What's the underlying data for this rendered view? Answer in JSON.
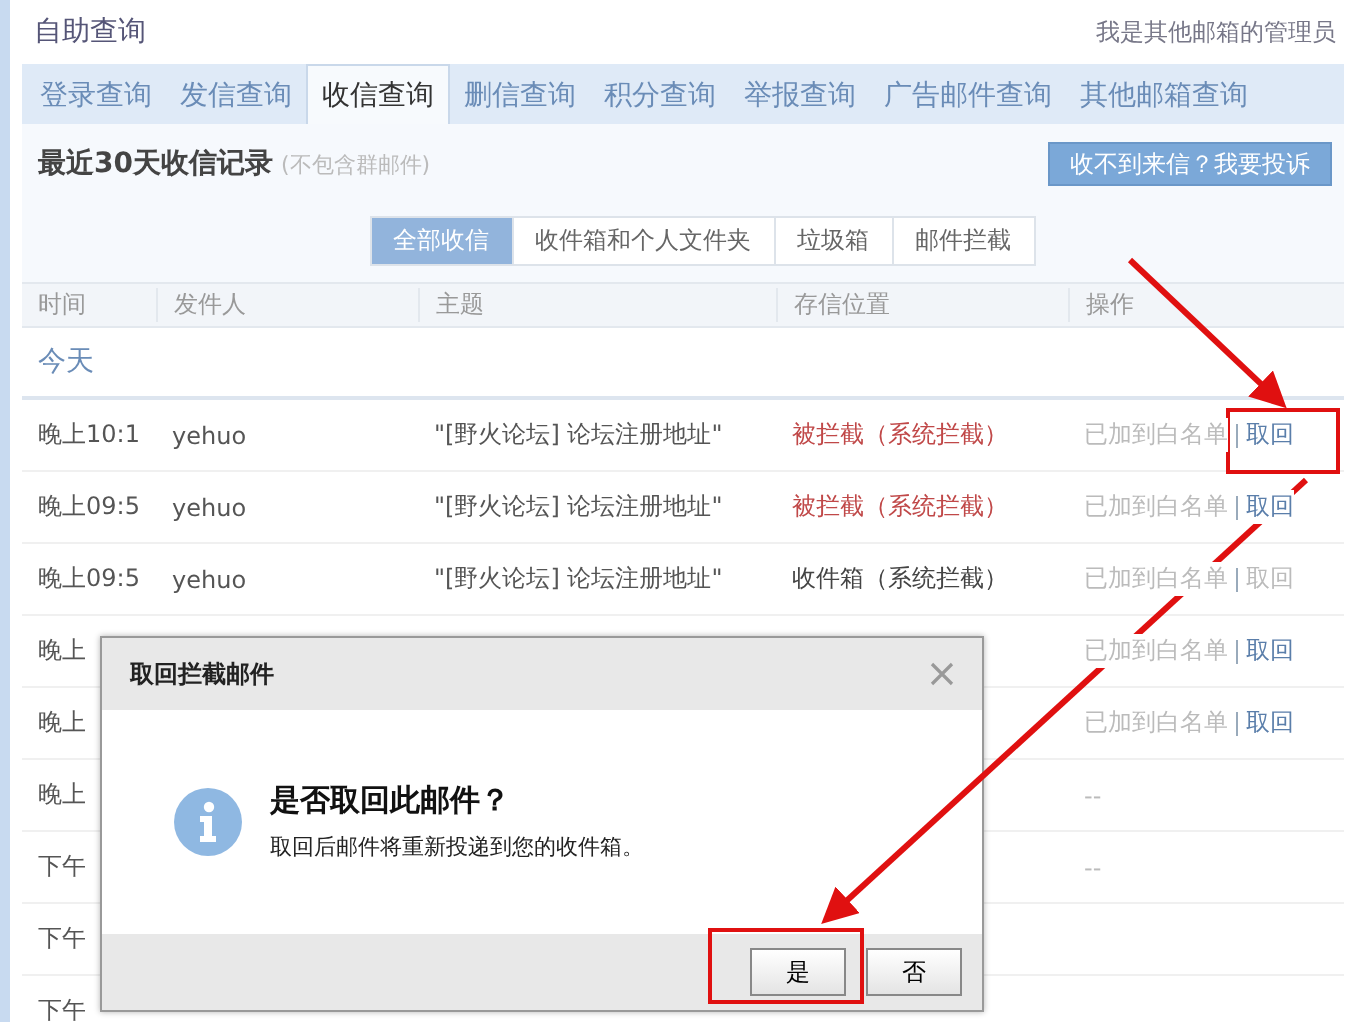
{
  "header": {
    "title": "自助查询",
    "admin_link": "我是其他邮箱的管理员"
  },
  "tabs": [
    {
      "label": "登录查询",
      "selected": false
    },
    {
      "label": "发信查询",
      "selected": false
    },
    {
      "label": "收信查询",
      "selected": true
    },
    {
      "label": "删信查询",
      "selected": false
    },
    {
      "label": "积分查询",
      "selected": false
    },
    {
      "label": "举报查询",
      "selected": false
    },
    {
      "label": "广告邮件查询",
      "selected": false
    },
    {
      "label": "其他邮箱查询",
      "selected": false
    }
  ],
  "section": {
    "title": "最近30天收信记录",
    "note": "(不包含群邮件)",
    "complain_button": "收不到来信？我要投诉"
  },
  "filters": [
    {
      "label": "全部收信",
      "selected": true
    },
    {
      "label": "收件箱和个人文件夹",
      "selected": false
    },
    {
      "label": "垃圾箱",
      "selected": false
    },
    {
      "label": "邮件拦截",
      "selected": false
    }
  ],
  "table": {
    "columns": [
      "时间",
      "发件人",
      "主题",
      "存信位置",
      "操作"
    ],
    "group": "今天",
    "rows": [
      {
        "time": "晚上10:1",
        "sender": "yehuo",
        "subject": "\"[野火论坛] 论坛注册地址\"",
        "location": "被拦截（系统拦截）",
        "kind": "blocked",
        "actions": [
          {
            "label": "已加到白名单",
            "disabled": true
          },
          {
            "label": "取回",
            "disabled": false
          }
        ]
      },
      {
        "time": "晚上09:5",
        "sender": "yehuo",
        "subject": "\"[野火论坛] 论坛注册地址\"",
        "location": "被拦截（系统拦截）",
        "kind": "blocked",
        "actions": [
          {
            "label": "已加到白名单",
            "disabled": true
          },
          {
            "label": "取回",
            "disabled": false
          }
        ]
      },
      {
        "time": "晚上09:5",
        "sender": "yehuo",
        "subject": "\"[野火论坛] 论坛注册地址\"",
        "location": "收件箱（系统拦截）",
        "kind": "inbox",
        "actions": [
          {
            "label": "已加到白名单",
            "disabled": true
          },
          {
            "label": "取回",
            "disabled": true
          }
        ]
      },
      {
        "time": "晚上",
        "actions": [
          {
            "label": "已加到白名单",
            "disabled": true
          },
          {
            "label": "取回",
            "disabled": false
          }
        ]
      },
      {
        "time": "晚上",
        "actions": [
          {
            "label": "已加到白名单",
            "disabled": true
          },
          {
            "label": "取回",
            "disabled": false
          }
        ]
      },
      {
        "time": "晚上",
        "actions": [
          {
            "label": "--",
            "disabled": true
          }
        ]
      },
      {
        "time": "下午",
        "actions": [
          {
            "label": "--",
            "disabled": true
          }
        ]
      },
      {
        "time": "下午"
      },
      {
        "time": "下午"
      }
    ]
  },
  "dialog": {
    "title": "取回拦截邮件",
    "question": "是否取回此邮件？",
    "detail": "取回后邮件将重新投递到您的收件箱。",
    "buttons": [
      "是",
      "否"
    ]
  }
}
